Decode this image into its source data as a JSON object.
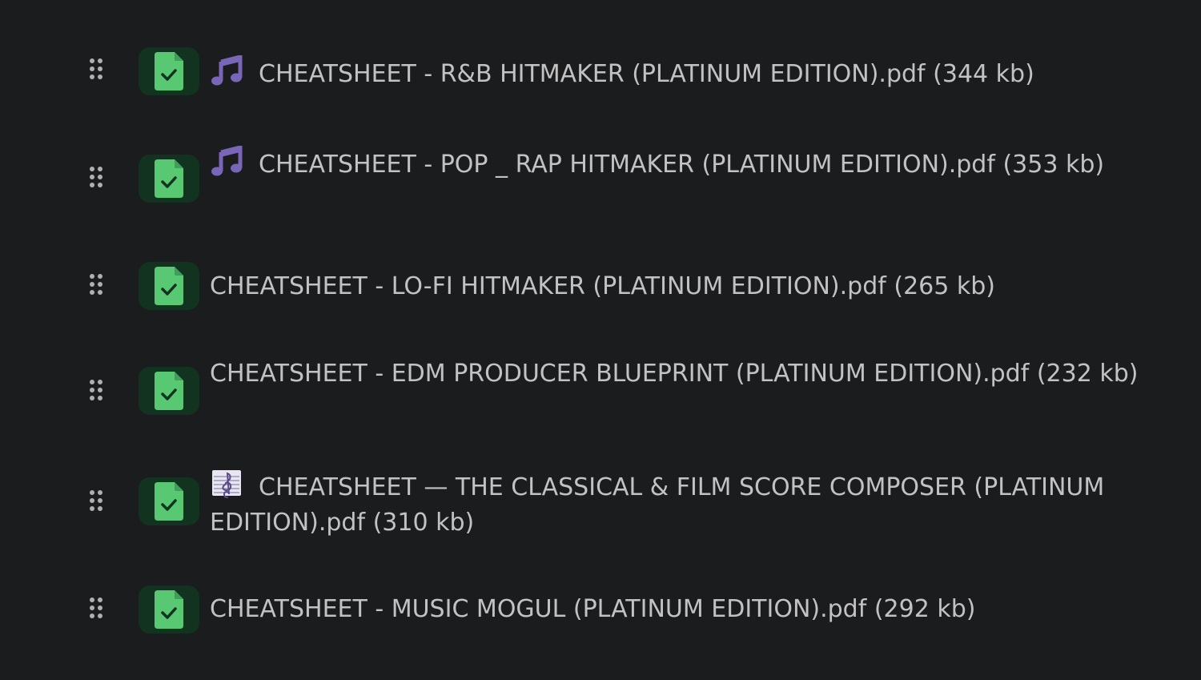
{
  "files": [
    {
      "emoji": "music-note-icon",
      "name": "CHEATSHEET - R&B HITMAKER (PLATINUM EDITION).pdf",
      "size": "(344 kb)"
    },
    {
      "emoji": "music-note-icon",
      "name": "CHEATSHEET - POP _ RAP HITMAKER (PLATINUM EDITION).pdf",
      "size": "(353 kb)"
    },
    {
      "emoji": "",
      "name": "CHEATSHEET - LO-FI HITMAKER (PLATINUM EDITION).pdf",
      "size": "(265 kb)"
    },
    {
      "emoji": "",
      "name": "CHEATSHEET - EDM PRODUCER BLUEPRINT (PLATINUM EDITION).pdf",
      "size": "(232 kb)"
    },
    {
      "emoji": "musical-score-icon",
      "name": "CHEATSHEET — THE CLASSICAL & FILM SCORE COMPOSER (PLATINUM EDITION).pdf",
      "size": "(310 kb)"
    },
    {
      "emoji": "",
      "name": "CHEATSHEET - MUSIC MOGUL (PLATINUM EDITION).pdf",
      "size": "(292 kb)"
    }
  ],
  "colors": {
    "background": "#1b1c1e",
    "text": "#c2c2c2",
    "badge_bg": "#12331f",
    "file_icon": "#58c873",
    "music_note": "#7a66b8",
    "handle": "#b0b0b0"
  }
}
